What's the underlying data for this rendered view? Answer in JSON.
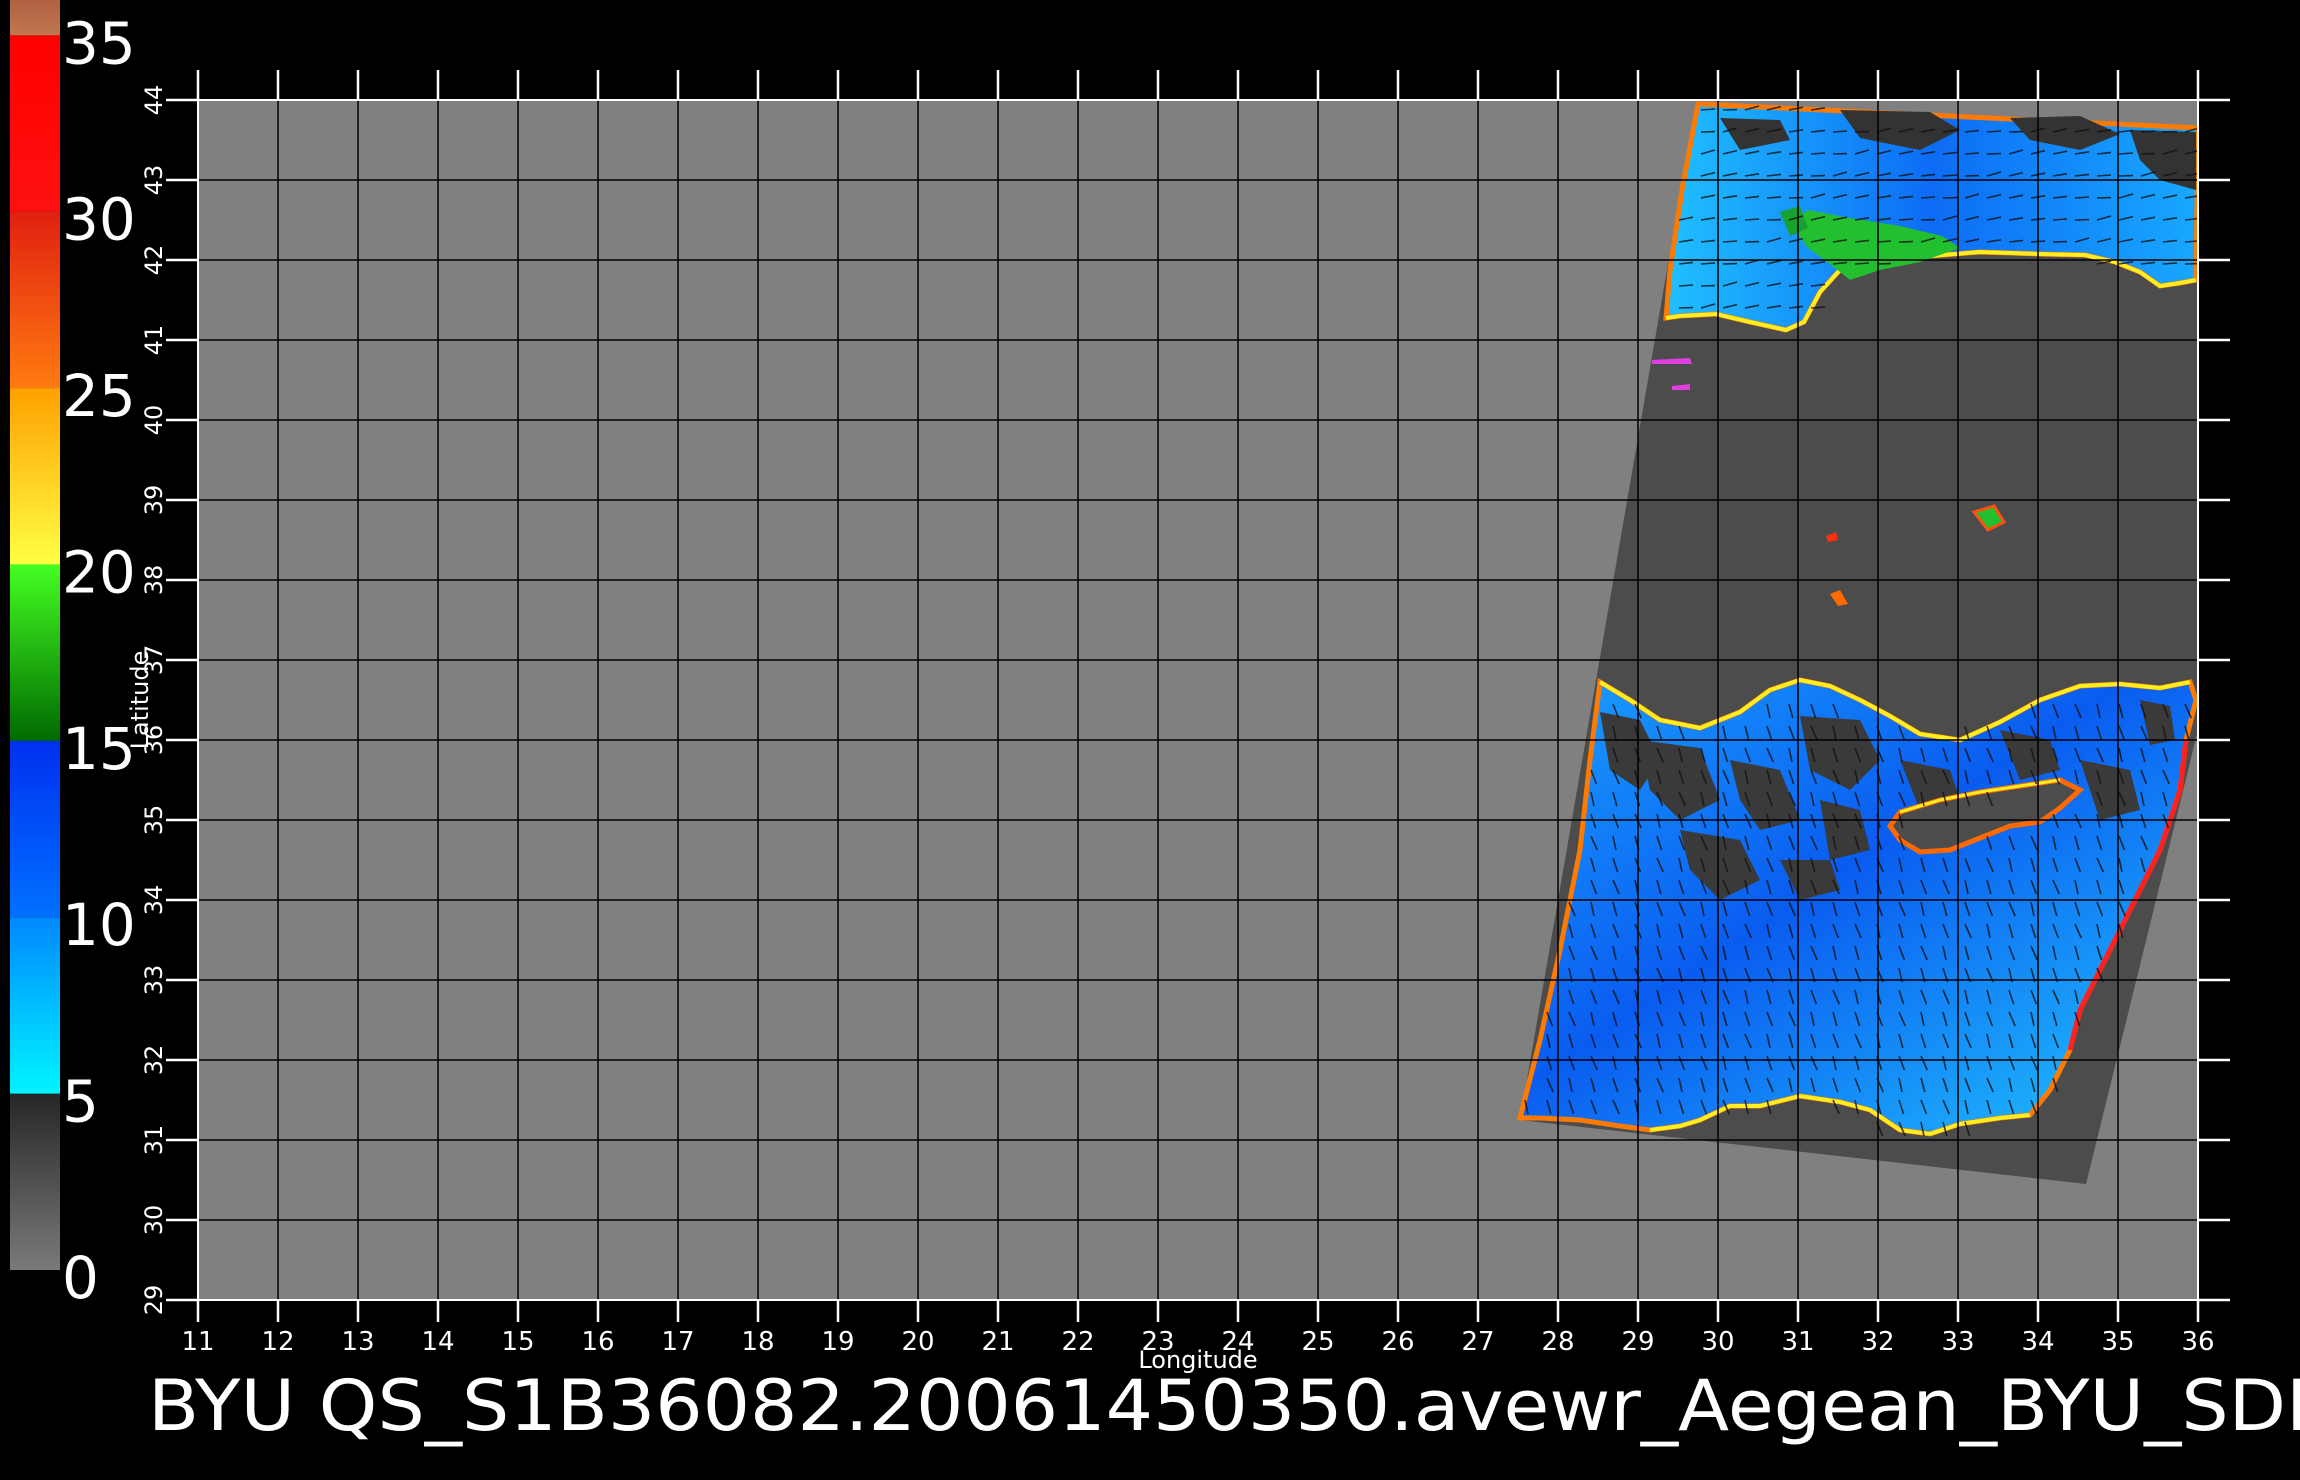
{
  "map": {
    "caption": "BYU  QS_S1B36082.20061450350.avewr_Aegean_BYU_SDI",
    "xlabel": "Longitude",
    "ylabel": "Latitude",
    "lon_range": [
      11,
      36
    ],
    "lat_range": [
      29,
      44
    ],
    "lon_ticks": [
      11,
      12,
      13,
      14,
      15,
      16,
      17,
      18,
      19,
      20,
      21,
      22,
      23,
      24,
      25,
      26,
      27,
      28,
      29,
      30,
      31,
      32,
      33,
      34,
      35,
      36
    ],
    "lat_ticks": [
      29,
      30,
      31,
      32,
      33,
      34,
      35,
      36,
      37,
      38,
      39,
      40,
      41,
      42,
      43,
      44
    ],
    "grid": true,
    "colors": {
      "background": "#000000",
      "land": "#808080",
      "swath_land": "#4a4a4a",
      "grid": "#000000",
      "text": "#ffffff"
    }
  },
  "colorbar": {
    "labels": [
      "35",
      "30",
      "25",
      "20",
      "15",
      "10",
      "5",
      "0"
    ],
    "values": [
      35,
      30,
      25,
      20,
      15,
      10,
      5,
      0
    ],
    "bands": [
      {
        "from": 0,
        "to": 5,
        "colors": [
          "#7a7a7a",
          "#262626"
        ]
      },
      {
        "from": 5,
        "to": 10,
        "colors": [
          "#00f4ff",
          "#0088ff"
        ]
      },
      {
        "from": 10,
        "to": 15,
        "colors": [
          "#0070ff",
          "#0030f0"
        ]
      },
      {
        "from": 15,
        "to": 20,
        "colors": [
          "#006a00",
          "#44ff22"
        ]
      },
      {
        "from": 20,
        "to": 25,
        "colors": [
          "#ffff44",
          "#ffa000"
        ]
      },
      {
        "from": 25,
        "to": 30,
        "colors": [
          "#ff7a10",
          "#e02010"
        ]
      },
      {
        "from": 30,
        "to": 35,
        "colors": [
          "#ff1010",
          "#ff0000"
        ]
      },
      {
        "from": 35,
        "to": 36,
        "colors": [
          "#c07850",
          "#b06040"
        ]
      }
    ]
  }
}
